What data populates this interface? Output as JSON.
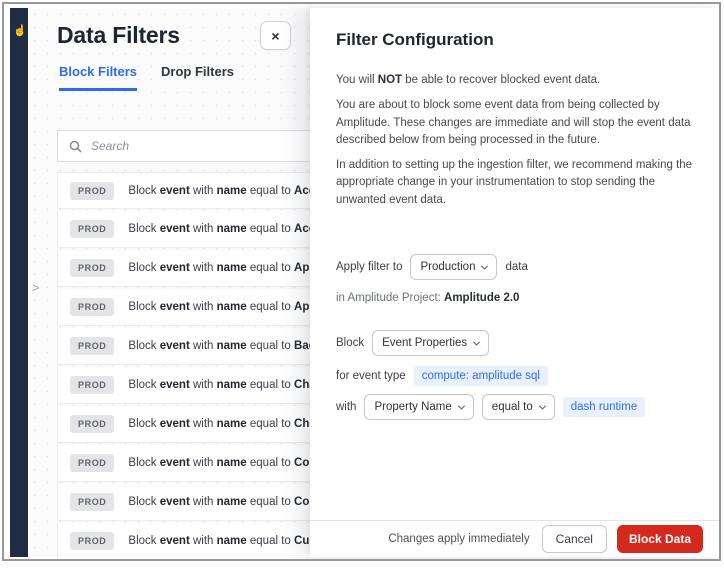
{
  "colors": {
    "accent_blue": "#2e6bf1",
    "danger_red": "#d5291d",
    "rail_navy": "#202c44",
    "chip_bg": "#e9f0fd",
    "badge_bg": "#e4e4e7"
  },
  "left_panel": {
    "title": "Data Filters",
    "close_label": "×",
    "tabs": [
      {
        "label": "Block Filters",
        "active": true
      },
      {
        "label": "Drop Filters",
        "active": false
      }
    ],
    "search_placeholder": "Search",
    "collapse_chevron": ">",
    "row_text": {
      "prefix": "Block",
      "mid1": "with",
      "mid2": "equal to"
    },
    "rows": [
      {
        "badge": "PROD",
        "entity": "event",
        "field": "name",
        "value": "Acco"
      },
      {
        "badge": "PROD",
        "entity": "event",
        "field": "name",
        "value": "Acco"
      },
      {
        "badge": "PROD",
        "entity": "event",
        "field": "name",
        "value": "App"
      },
      {
        "badge": "PROD",
        "entity": "event",
        "field": "name",
        "value": "App"
      },
      {
        "badge": "PROD",
        "entity": "event",
        "field": "name",
        "value": "Back"
      },
      {
        "badge": "PROD",
        "entity": "event",
        "field": "name",
        "value": "Char"
      },
      {
        "badge": "PROD",
        "entity": "event",
        "field": "name",
        "value": "Chec"
      },
      {
        "badge": "PROD",
        "entity": "event",
        "field": "name",
        "value": "Com"
      },
      {
        "badge": "PROD",
        "entity": "event",
        "field": "name",
        "value": "Com"
      },
      {
        "badge": "PROD",
        "entity": "event",
        "field": "name",
        "value": "Cust"
      }
    ]
  },
  "drawer": {
    "title": "Filter Configuration",
    "warning": {
      "pre": "You will ",
      "bold": "NOT",
      "post": " be able to recover blocked event data."
    },
    "para2": "You are about to block some event data from being collected by Amplitude. These changes are immediate and will stop the event data described below from being processed in the future.",
    "para3": "In addition to setting up the ingestion filter, we recommend making the appropriate change in your instrumentation to stop sending the unwanted event data.",
    "apply_row": {
      "prefix": "Apply filter to",
      "dropdown": "Production",
      "suffix": "data"
    },
    "project_line": {
      "prefix": "in Amplitude Project: ",
      "bold": "Amplitude 2.0"
    },
    "block_row": {
      "prefix": "Block",
      "dropdown": "Event Properties"
    },
    "etype_row": {
      "prefix": "for event type",
      "chip": "compute: amplitude sql"
    },
    "with_row": {
      "prefix": "with",
      "dropdown1": "Property Name",
      "dropdown2": "equal to",
      "chip": "dash runtime"
    },
    "footer": {
      "note": "Changes apply immediately",
      "cancel": "Cancel",
      "submit": "Block Data"
    }
  }
}
